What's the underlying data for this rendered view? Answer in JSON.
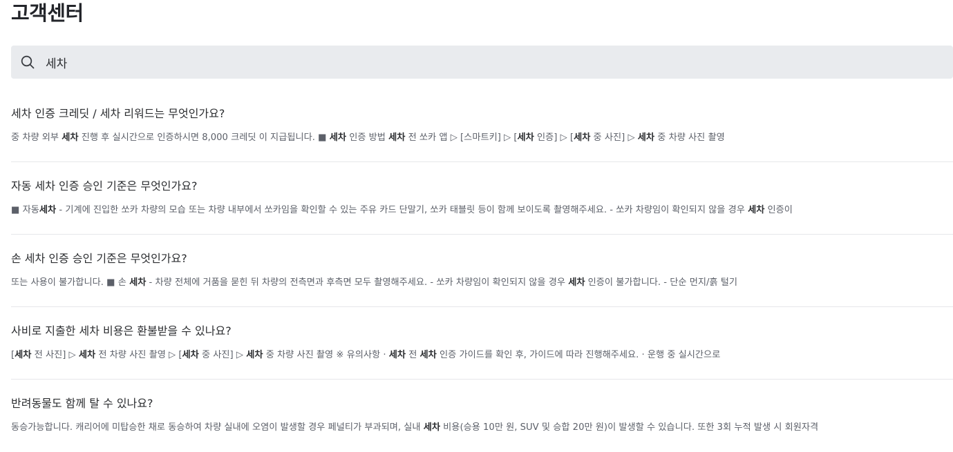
{
  "page": {
    "title": "고객센터"
  },
  "search": {
    "value": "세차",
    "icon": "search-icon"
  },
  "faqs": [
    {
      "question": "세차 인증 크레딧 / 세차 리워드는 무엇인가요?",
      "snippet": [
        {
          "text": "중 차량 외부 ",
          "bold": false
        },
        {
          "text": "세차",
          "bold": true
        },
        {
          "text": " 진행 후 실시간으로 인증하시면 8,000 크레딧 이 지급됩니다. ■ ",
          "bold": false
        },
        {
          "text": "세차",
          "bold": true
        },
        {
          "text": " 인증 방법 ",
          "bold": false
        },
        {
          "text": "세차",
          "bold": true
        },
        {
          "text": " 전 쏘카 앱 ▷ [스마트키] ▷ [",
          "bold": false
        },
        {
          "text": "세차",
          "bold": true
        },
        {
          "text": " 인증] ▷ [",
          "bold": false
        },
        {
          "text": "세차",
          "bold": true
        },
        {
          "text": " 중 사진] ▷ ",
          "bold": false
        },
        {
          "text": "세차",
          "bold": true
        },
        {
          "text": " 중 차량 사진 촬영",
          "bold": false
        }
      ]
    },
    {
      "question": "자동 세차 인증 승인 기준은 무엇인가요?",
      "snippet": [
        {
          "text": "■ 자동",
          "bold": false
        },
        {
          "text": "세차",
          "bold": true
        },
        {
          "text": " - 기계에 진입한 쏘카 차량의 모습 또는 차량 내부에서 쏘카임을 확인할 수 있는 주유 카드 단말기, 쏘카 태블릿 등이 함께 보이도록 촬영해주세요. - 쏘카 차량임이 확인되지 않을 경우 ",
          "bold": false
        },
        {
          "text": "세차",
          "bold": true
        },
        {
          "text": " 인증이",
          "bold": false
        }
      ]
    },
    {
      "question": "손 세차 인증 승인 기준은 무엇인가요?",
      "snippet": [
        {
          "text": "또는 사용이 불가합니다. ■ 손 ",
          "bold": false
        },
        {
          "text": "세차",
          "bold": true
        },
        {
          "text": " - 차량 전체에 거품을 묻힌 뒤 차량의 전측면과 후측면 모두 촬영해주세요. - 쏘카 차량임이 확인되지 않을 경우 ",
          "bold": false
        },
        {
          "text": "세차",
          "bold": true
        },
        {
          "text": " 인증이 불가합니다. - 단순 먼지/흙 털기",
          "bold": false
        }
      ]
    },
    {
      "question": "사비로 지출한 세차 비용은 환불받을 수 있나요?",
      "snippet": [
        {
          "text": "[",
          "bold": false
        },
        {
          "text": "세차",
          "bold": true
        },
        {
          "text": " 전 사진] ▷ ",
          "bold": false
        },
        {
          "text": "세차",
          "bold": true
        },
        {
          "text": " 전 차량 사진 촬영 ▷ [",
          "bold": false
        },
        {
          "text": "세차",
          "bold": true
        },
        {
          "text": " 중 사진] ▷ ",
          "bold": false
        },
        {
          "text": "세차",
          "bold": true
        },
        {
          "text": " 중 차량 사진 촬영 ※ 유의사항 · ",
          "bold": false
        },
        {
          "text": "세차",
          "bold": true
        },
        {
          "text": " 전 ",
          "bold": false
        },
        {
          "text": "세차",
          "bold": true
        },
        {
          "text": " 인증 가이드를 확인 후, 가이드에 따라 진행해주세요. · 운행 중 실시간으로",
          "bold": false
        }
      ]
    },
    {
      "question": "반려동물도 함께 탈 수 있나요?",
      "snippet": [
        {
          "text": "동승가능합니다. 캐리어에 미탑승한 채로 동승하여 차량 실내에 오염이 발생할 경우 페널티가 부과되며, 실내 ",
          "bold": false
        },
        {
          "text": "세차",
          "bold": true
        },
        {
          "text": " 비용(승용 10만 원, SUV 및 승합 20만 원)이 발생할 수 있습니다. 또한 3회 누적 발생 시 회원자격",
          "bold": false
        }
      ]
    }
  ]
}
